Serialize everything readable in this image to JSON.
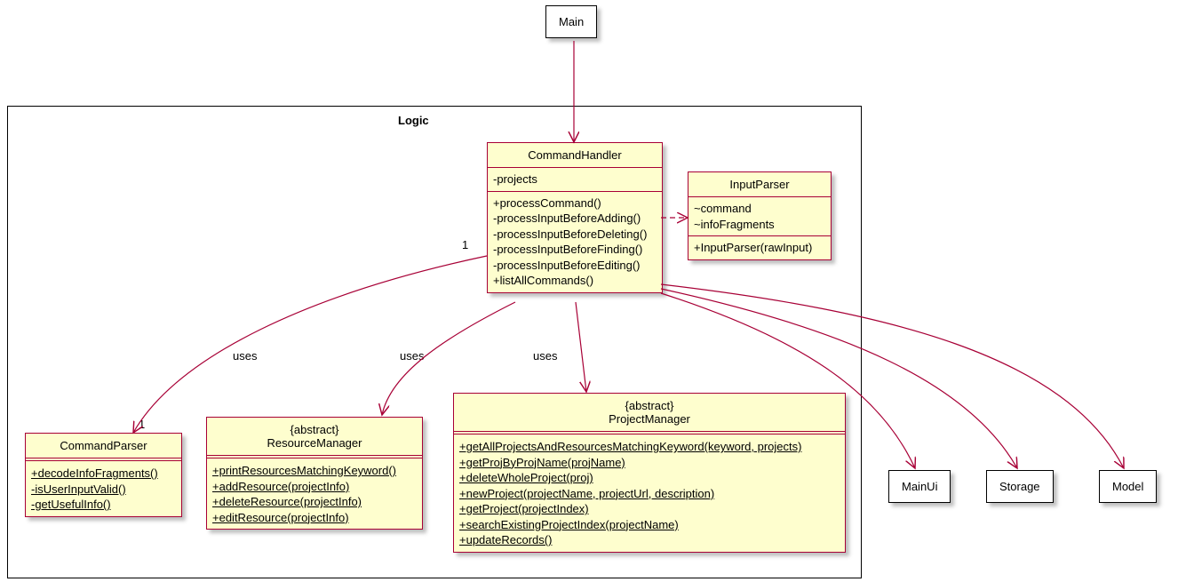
{
  "package": {
    "label": "Logic"
  },
  "nodes": {
    "main": {
      "label": "Main"
    },
    "mainui": {
      "label": "MainUi"
    },
    "storage": {
      "label": "Storage"
    },
    "model": {
      "label": "Model"
    }
  },
  "classes": {
    "commandHandler": {
      "title": "CommandHandler",
      "attrs": [
        "-projects"
      ],
      "ops": [
        "+processCommand()",
        "-processInputBeforeAdding()",
        "-processInputBeforeDeleting()",
        "-processInputBeforeFinding()",
        "-processInputBeforeEditing()",
        "+listAllCommands()"
      ]
    },
    "inputParser": {
      "title": "InputParser",
      "attrs": [
        "~command",
        "~infoFragments"
      ],
      "ops": [
        "+InputParser(rawInput)"
      ]
    },
    "commandParser": {
      "title": "CommandParser",
      "ops": [
        "+decodeInfoFragments()",
        "-isUserInputValid()",
        "-getUsefulInfo()"
      ]
    },
    "resourceManager": {
      "stereo": "{abstract}",
      "title": "ResourceManager",
      "ops": [
        "+printResourcesMatchingKeyword()",
        "+addResource(projectInfo)",
        "+deleteResource(projectInfo)",
        "+editResource(projectInfo)"
      ]
    },
    "projectManager": {
      "stereo": "{abstract}",
      "title": "ProjectManager",
      "ops": [
        "+getAllProjectsAndResourcesMatchingKeyword(keyword, projects)",
        "+getProjByProjName(projName)",
        "+deleteWholeProject(proj)",
        "+newProject(projectName, projectUrl, description)",
        "+getProject(projectIndex)",
        "+searchExistingProjectIndex(projectName)",
        "+updateRecords()"
      ]
    }
  },
  "edgeLabels": {
    "uses1": "uses",
    "uses2": "uses",
    "uses3": "uses",
    "mult1": "1",
    "mult1b": "1"
  },
  "chart_data": {
    "type": "uml-class-diagram",
    "package": "Logic",
    "external_nodes": [
      "Main",
      "MainUi",
      "Storage",
      "Model"
    ],
    "classes": [
      {
        "name": "CommandHandler",
        "abstract": false,
        "attributes": [
          "-projects"
        ],
        "operations": [
          "+processCommand()",
          "-processInputBeforeAdding()",
          "-processInputBeforeDeleting()",
          "-processInputBeforeFinding()",
          "-processInputBeforeEditing()",
          "+listAllCommands()"
        ]
      },
      {
        "name": "InputParser",
        "abstract": false,
        "attributes": [
          "~command",
          "~infoFragments"
        ],
        "operations": [
          "+InputParser(rawInput)"
        ]
      },
      {
        "name": "CommandParser",
        "abstract": false,
        "attributes": [],
        "operations": [
          "+decodeInfoFragments()",
          "-isUserInputValid()",
          "-getUsefulInfo()"
        ],
        "members_static": true
      },
      {
        "name": "ResourceManager",
        "abstract": true,
        "attributes": [],
        "operations": [
          "+printResourcesMatchingKeyword()",
          "+addResource(projectInfo)",
          "+deleteResource(projectInfo)",
          "+editResource(projectInfo)"
        ],
        "members_static": true
      },
      {
        "name": "ProjectManager",
        "abstract": true,
        "attributes": [],
        "operations": [
          "+getAllProjectsAndResourcesMatchingKeyword(keyword, projects)",
          "+getProjByProjName(projName)",
          "+deleteWholeProject(proj)",
          "+newProject(projectName, projectUrl, description)",
          "+getProject(projectIndex)",
          "+searchExistingProjectIndex(projectName)",
          "+updateRecords()"
        ],
        "members_static": true
      }
    ],
    "relationships": [
      {
        "from": "Main",
        "to": "CommandHandler",
        "type": "association",
        "arrow": "open"
      },
      {
        "from": "CommandHandler",
        "to": "InputParser",
        "type": "dependency",
        "style": "dashed",
        "arrow": "open"
      },
      {
        "from": "CommandHandler",
        "to": "CommandParser",
        "type": "association",
        "label": "uses",
        "from_mult": "1",
        "to_mult": "1",
        "arrow": "open"
      },
      {
        "from": "CommandHandler",
        "to": "ResourceManager",
        "type": "association",
        "label": "uses",
        "arrow": "open"
      },
      {
        "from": "CommandHandler",
        "to": "ProjectManager",
        "type": "association",
        "label": "uses",
        "arrow": "open"
      },
      {
        "from": "CommandHandler",
        "to": "MainUi",
        "type": "association",
        "arrow": "open"
      },
      {
        "from": "CommandHandler",
        "to": "Storage",
        "type": "association",
        "arrow": "open"
      },
      {
        "from": "CommandHandler",
        "to": "Model",
        "type": "association",
        "arrow": "open"
      }
    ]
  }
}
